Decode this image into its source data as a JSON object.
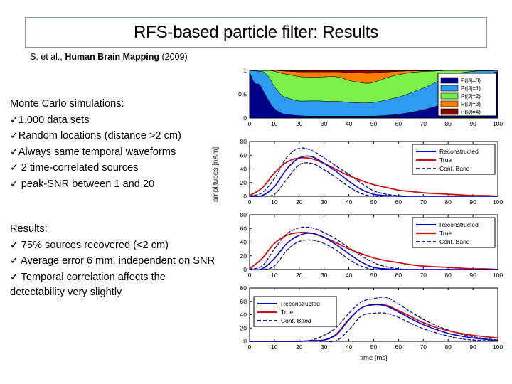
{
  "slide": {
    "title": "RFS-based particle filter: Results",
    "citation_plain_1": "S. et al., ",
    "citation_bold": "Human Brain Mapping",
    "citation_plain_2": " (2009)"
  },
  "blocks": [
    {
      "name": "monte-carlo",
      "heading": "Monte Carlo simulations:",
      "items": [
        "1.000 data sets",
        "Random locations (distance >2 cm)",
        "Always same temporal waveforms",
        " 2 time-correlated sources",
        " peak-SNR between 1 and 20"
      ]
    },
    {
      "name": "results",
      "heading": "Results:",
      "items": [
        " 75% sources recovered (<2 cm)",
        " Average error 6 mm, independent on SNR",
        " Temporal correlation affects the detectability very slightly"
      ]
    }
  ],
  "icons": {
    "check": "✓"
  },
  "colors": {
    "title_border": "#8497a6",
    "series_p0": "#00008b",
    "series_p1": "#2e9bf0",
    "series_p2": "#7cf04a",
    "series_p3": "#ff8000",
    "series_p4": "#8b0000",
    "reconstructed": "#0000cc",
    "true": "#cc1111",
    "conf_band": "#0b0b8b"
  },
  "chart_data": [
    {
      "type": "area",
      "name": "cardinality-probabilities",
      "title": "",
      "xlabel": "",
      "ylabel": "",
      "xlim": [
        0,
        100
      ],
      "ylim": [
        0,
        1
      ],
      "xticks": [
        0,
        10,
        20,
        30,
        40,
        50,
        60,
        70,
        80,
        90,
        100
      ],
      "yticks": [
        0,
        0.5,
        1
      ],
      "grid": false,
      "legend_position": "right",
      "stacked": true,
      "x": [
        0,
        2,
        4,
        6,
        8,
        10,
        13,
        16,
        20,
        24,
        28,
        32,
        36,
        40,
        44,
        48,
        52,
        56,
        60,
        64,
        68,
        72,
        76,
        80,
        84,
        88,
        92,
        96,
        100
      ],
      "series": [
        {
          "name": "P(|J|=0)",
          "values": [
            0.96,
            0.74,
            0.7,
            0.52,
            0.34,
            0.2,
            0.1,
            0.07,
            0.05,
            0.04,
            0.04,
            0.04,
            0.04,
            0.04,
            0.04,
            0.04,
            0.045,
            0.06,
            0.08,
            0.11,
            0.15,
            0.2,
            0.26,
            0.33,
            0.5,
            0.66,
            0.82,
            0.93,
            0.97
          ]
        },
        {
          "name": "P(|J|=1)",
          "values": [
            0.04,
            0.25,
            0.28,
            0.44,
            0.5,
            0.46,
            0.38,
            0.34,
            0.31,
            0.32,
            0.32,
            0.31,
            0.31,
            0.29,
            0.28,
            0.28,
            0.3,
            0.33,
            0.36,
            0.4,
            0.44,
            0.47,
            0.52,
            0.55,
            0.44,
            0.31,
            0.17,
            0.06,
            0.03
          ]
        },
        {
          "name": "P(|J|=2)",
          "values": [
            0.0,
            0.01,
            0.02,
            0.04,
            0.16,
            0.32,
            0.46,
            0.5,
            0.51,
            0.5,
            0.5,
            0.52,
            0.51,
            0.46,
            0.43,
            0.41,
            0.44,
            0.47,
            0.47,
            0.44,
            0.38,
            0.31,
            0.21,
            0.12,
            0.06,
            0.03,
            0.01,
            0.01,
            0.0
          ]
        },
        {
          "name": "P(|J|=3)",
          "values": [
            0.0,
            0.0,
            0.0,
            0.0,
            0.0,
            0.02,
            0.05,
            0.07,
            0.1,
            0.11,
            0.11,
            0.1,
            0.11,
            0.16,
            0.2,
            0.21,
            0.17,
            0.11,
            0.07,
            0.04,
            0.02,
            0.01,
            0.01,
            0.0,
            0.0,
            0.0,
            0.0,
            0.0,
            0.0
          ]
        },
        {
          "name": "P(|J|=4)",
          "values": [
            0.0,
            0.0,
            0.0,
            0.0,
            0.0,
            0.0,
            0.01,
            0.02,
            0.03,
            0.03,
            0.03,
            0.03,
            0.03,
            0.05,
            0.05,
            0.06,
            0.045,
            0.03,
            0.02,
            0.01,
            0.01,
            0.01,
            0.0,
            0.0,
            0.0,
            0.0,
            0.0,
            0.0,
            0.0
          ]
        }
      ]
    },
    {
      "type": "line",
      "name": "source-1-waveform",
      "title": "",
      "xlabel": "",
      "ylabel": "amplitudes [nAm]",
      "xlim": [
        0,
        100
      ],
      "ylim": [
        0,
        80
      ],
      "xticks": [
        0,
        10,
        20,
        30,
        40,
        50,
        60,
        70,
        80,
        90,
        100
      ],
      "yticks": [
        0,
        20,
        40,
        60,
        80
      ],
      "grid": false,
      "legend_position": "top-right",
      "legend": [
        "Reconstructed",
        "True",
        "Conf. Band"
      ],
      "x": [
        0,
        5,
        10,
        15,
        20,
        25,
        30,
        35,
        40,
        45,
        50,
        55,
        60,
        65,
        70,
        75,
        80,
        85,
        90,
        95,
        100
      ],
      "series": [
        {
          "name": "Reconstructed",
          "values": [
            0,
            1,
            14,
            40,
            56,
            58,
            48,
            36,
            22,
            10,
            3,
            1,
            0,
            0,
            0,
            0,
            0,
            0,
            0,
            0,
            0
          ]
        },
        {
          "name": "True",
          "values": [
            1,
            12,
            34,
            50,
            56,
            55,
            48,
            39,
            30,
            23,
            17,
            13,
            9,
            7,
            5,
            4,
            3,
            2,
            1,
            1,
            0
          ]
        },
        {
          "name": "Conf. Band upper",
          "values": [
            1,
            5,
            26,
            57,
            70,
            67,
            56,
            44,
            32,
            19,
            8,
            3,
            1,
            0,
            0,
            0,
            0,
            0,
            0,
            0,
            0
          ]
        },
        {
          "name": "Conf. Band lower",
          "values": [
            0,
            0,
            3,
            25,
            46,
            48,
            39,
            27,
            14,
            4,
            0,
            0,
            0,
            0,
            0,
            0,
            0,
            0,
            0,
            0,
            0
          ]
        }
      ]
    },
    {
      "type": "line",
      "name": "source-2-waveform",
      "title": "",
      "xlabel": "",
      "ylabel": "amplitudes [nAm]",
      "xlim": [
        0,
        100
      ],
      "ylim": [
        0,
        80
      ],
      "xticks": [
        0,
        10,
        20,
        30,
        40,
        50,
        60,
        70,
        80,
        90,
        100
      ],
      "yticks": [
        0,
        20,
        40,
        60,
        80
      ],
      "grid": false,
      "legend_position": "top-right",
      "legend": [
        "Reconstructed",
        "True",
        "Conf. Band"
      ],
      "x": [
        0,
        5,
        10,
        15,
        20,
        25,
        30,
        35,
        40,
        45,
        50,
        55,
        60,
        65,
        70,
        75,
        80,
        85,
        90,
        95,
        100
      ],
      "series": [
        {
          "name": "Reconstructed",
          "values": [
            0,
            1,
            16,
            38,
            50,
            53,
            47,
            36,
            23,
            11,
            3,
            1,
            0,
            0,
            0,
            0,
            0,
            0,
            0,
            0,
            0
          ]
        },
        {
          "name": "True",
          "values": [
            1,
            16,
            38,
            50,
            54,
            53,
            47,
            39,
            30,
            23,
            17,
            13,
            10,
            7,
            5,
            4,
            3,
            2,
            1,
            1,
            0
          ]
        },
        {
          "name": "Conf. Band upper",
          "values": [
            1,
            5,
            30,
            52,
            61,
            61,
            54,
            44,
            32,
            20,
            10,
            4,
            1,
            0,
            0,
            0,
            0,
            0,
            0,
            0,
            0
          ]
        },
        {
          "name": "Conf. Band lower",
          "values": [
            0,
            0,
            5,
            28,
            41,
            43,
            38,
            28,
            15,
            5,
            0,
            0,
            0,
            0,
            0,
            0,
            0,
            0,
            0,
            0,
            0
          ]
        }
      ]
    },
    {
      "type": "line",
      "name": "source-3-waveform",
      "title": "",
      "xlabel": "time [ms]",
      "ylabel": "amplitudes [nAm]",
      "xlim": [
        0,
        100
      ],
      "ylim": [
        0,
        80
      ],
      "xticks": [
        0,
        10,
        20,
        30,
        40,
        50,
        60,
        70,
        80,
        90,
        100
      ],
      "yticks": [
        0,
        20,
        40,
        60,
        80
      ],
      "grid": false,
      "legend_position": "top-left",
      "legend": [
        "Reconstructed",
        "True",
        "Conf. Band"
      ],
      "x": [
        0,
        5,
        10,
        15,
        20,
        25,
        30,
        35,
        40,
        45,
        50,
        55,
        60,
        65,
        70,
        75,
        80,
        85,
        90,
        95,
        100
      ],
      "series": [
        {
          "name": "Reconstructed",
          "values": [
            0,
            0,
            0,
            0,
            0,
            1,
            2,
            10,
            32,
            50,
            55,
            53,
            44,
            34,
            25,
            18,
            12,
            8,
            5,
            3,
            1
          ]
        },
        {
          "name": "True",
          "values": [
            0,
            0,
            0,
            0,
            0,
            1,
            2,
            11,
            33,
            50,
            55,
            54,
            46,
            37,
            28,
            21,
            16,
            12,
            9,
            7,
            5
          ]
        },
        {
          "name": "Conf. Band upper",
          "values": [
            0,
            0,
            0,
            0,
            0,
            2,
            9,
            21,
            42,
            59,
            64,
            66,
            56,
            44,
            33,
            24,
            17,
            11,
            7,
            4,
            2
          ]
        },
        {
          "name": "Conf. Band lower",
          "values": [
            0,
            0,
            0,
            0,
            0,
            0,
            0,
            1,
            17,
            38,
            42,
            42,
            36,
            27,
            19,
            13,
            8,
            4,
            2,
            1,
            0
          ]
        }
      ]
    }
  ]
}
